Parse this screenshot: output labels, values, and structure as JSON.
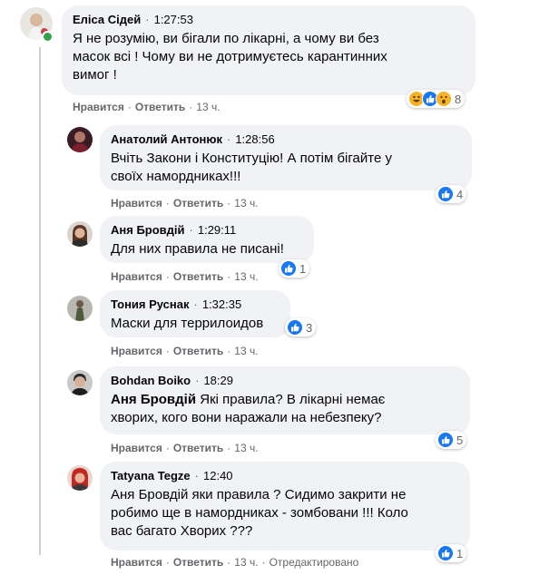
{
  "actions": {
    "like": "Нравится",
    "reply": "Ответить"
  },
  "root": {
    "author": "Еліса Сідей",
    "time": "1:27:53",
    "text_lines": [
      "Я не розумію, ви бігали по лікарні, а чому ви без",
      "масок всі ! Чому ви не дотримуєтесь карантинних",
      "вимог !"
    ],
    "age": "13 ч.",
    "reaction_icons": [
      "haha-icon",
      "like-icon",
      "wow-icon"
    ],
    "reaction_count": "8"
  },
  "replies": [
    {
      "author": "Анатолий Антонюк",
      "time": "1:28:56",
      "text_lines": [
        "Вчіть Закони і Конституцію! А потім бігайте у",
        "своїх намордниках!!!"
      ],
      "age": "13 ч.",
      "reaction_count": "4"
    },
    {
      "author": "Аня Бровдій",
      "time": "1:29:11",
      "text_lines": [
        "Для них правила не писані!"
      ],
      "age": "13 ч.",
      "reaction_count": "1"
    },
    {
      "author": "Тония Руснак",
      "time": "1:32:35",
      "text_lines": [
        "Маски для террилоидов"
      ],
      "age": "13 ч.",
      "reaction_count": "3"
    },
    {
      "author": "Bohdan Boiko",
      "time": "18:29",
      "mention": "Аня Бровдій",
      "text_lines": [
        " Які правила? В лікарні немає",
        "хворих, кого вони наражали на небезпеку?"
      ],
      "age": "13 ч.",
      "reaction_count": "5"
    },
    {
      "author": "Tatyana Tegze",
      "time": "12:40",
      "text_lines": [
        "Аня Бровдій яки правила ? Сидимо закрити не",
        "робимо ще в намордниках - зомбовани !!! Коло",
        "вас багато Хворих ???"
      ],
      "age": "13 ч.",
      "edited": "Отредактировано",
      "reaction_count": "1"
    }
  ],
  "colors": {
    "bubble": "#f0f2f5",
    "like_blue": "#1877f2",
    "haha_yellow": "#f7b125",
    "secondary_text": "#65676b",
    "online_green": "#31a24c"
  }
}
